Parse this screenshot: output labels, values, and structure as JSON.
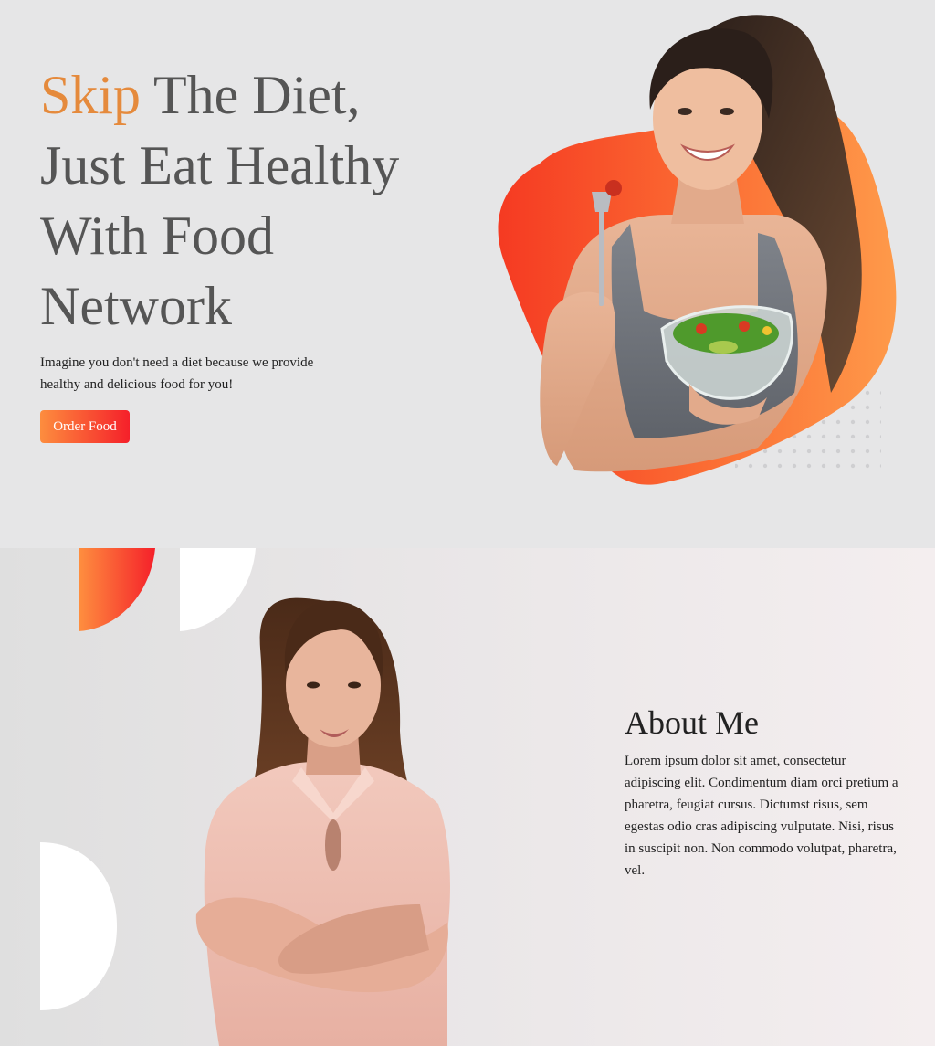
{
  "hero": {
    "title_accent": "Skip",
    "title_rest": " The Diet, Just Eat Healthy With Food Network",
    "subtitle": "Imagine you don't need a diet because we provide healthy and delicious food for you!",
    "order_button_label": "Order Food"
  },
  "about": {
    "heading": "About Me",
    "body": "Lorem ipsum dolor sit amet, consectetur adipiscing elit. Condimentum diam orci pretium a pharetra, feugiat cursus. Dictumst risus, sem egestas odio cras adipiscing vulputate. Nisi, risus in suscipit non. Non commodo volutpat, pharetra, vel."
  },
  "colors": {
    "accent_text": "#e58a3c",
    "gradient_start": "#fd8d3e",
    "gradient_end": "#f5202a",
    "heading_text": "#555555",
    "body_text": "#222222"
  }
}
